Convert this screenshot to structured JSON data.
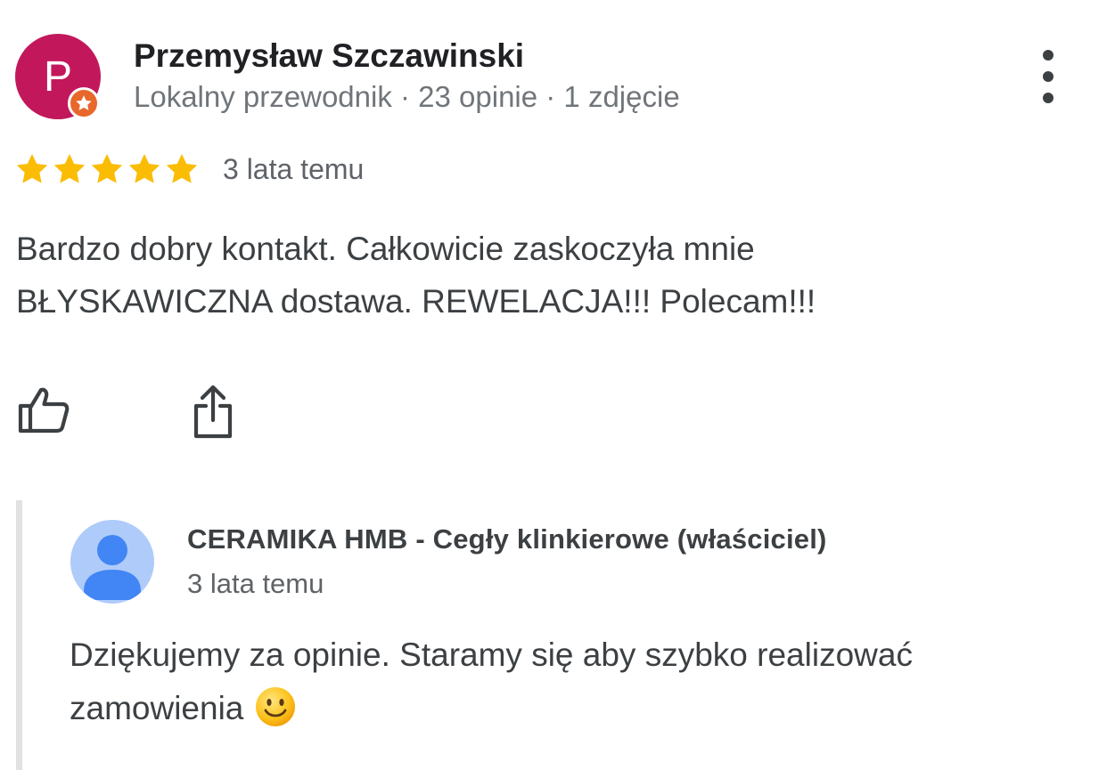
{
  "review": {
    "avatar_letter": "P",
    "avatar_color": "#c2185b",
    "badge_icon": "local-guide-star-icon",
    "badge_color": "#e8672b",
    "author_name": "Przemysław Szczawinski",
    "author_meta": "Lokalny przewodnik · 23 opinie · 1 zdjęcie",
    "rating": 5,
    "rating_max": 5,
    "star_color": "#fbbc04",
    "date": "3 lata temu",
    "text_line1": "Bardzo dobry kontakt. Całkowicie zaskoczyła mnie",
    "text_line2": "BŁYSKAWICZNA dostawa. REWELACJA!!! Polecam!!!",
    "actions": {
      "like_icon": "thumbs-up-icon",
      "share_icon": "share-icon",
      "more_icon": "more-vert-icon"
    }
  },
  "owner_reply": {
    "avatar_icon": "person-icon",
    "avatar_color": "#aecbfa",
    "name": "CERAMIKA HMB - Cegły klinkierowe (właściciel)",
    "date": "3 lata temu",
    "text_line1": "Dziękujemy za opinie. Staramy się aby szybko realizować",
    "text_line2": "zamowienia",
    "emoji_icon": "smiling-face-emoji"
  }
}
